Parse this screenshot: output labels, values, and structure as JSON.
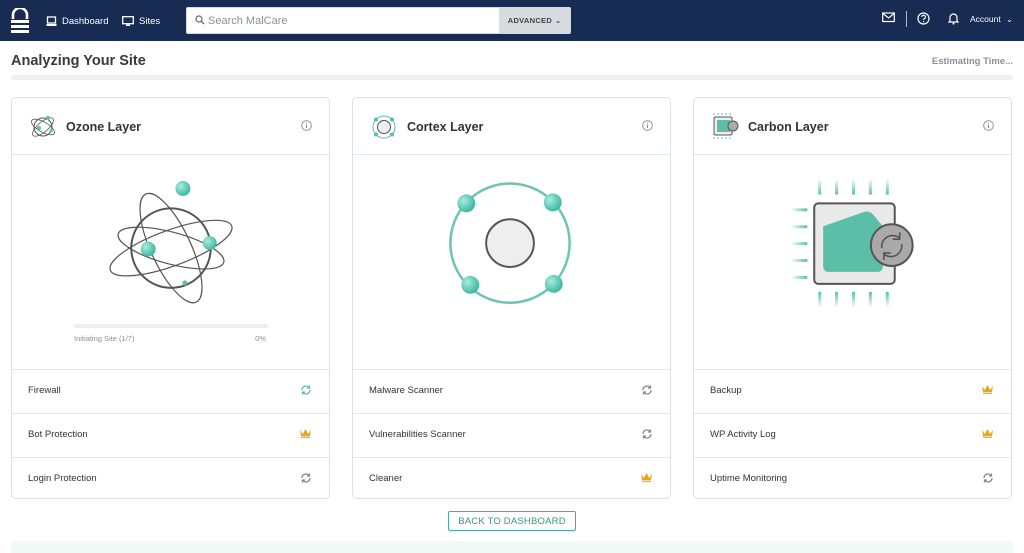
{
  "nav": {
    "dashboard": "Dashboard",
    "sites": "Sites",
    "search_placeholder": "Search MalCare",
    "advanced": "ADVANCED",
    "account": "Account",
    "icons": [
      "logo-icon",
      "dashboard-icon",
      "sites-icon",
      "search-icon",
      "mail-icon",
      "help-icon",
      "bell-icon",
      "chevron-down-icon"
    ]
  },
  "header": {
    "title": "Analyzing Your Site",
    "estimate": "Estimating Time..."
  },
  "cards": [
    {
      "title": "Ozone Layer",
      "progress_label": "Initiating Site (1/7)",
      "progress_pct": "0%",
      "progress_value": 0,
      "features": [
        {
          "label": "Firewall",
          "icon": "refresh-icon"
        },
        {
          "label": "Bot Protection",
          "icon": "crown-icon"
        },
        {
          "label": "Login Protection",
          "icon": "refresh-icon"
        }
      ]
    },
    {
      "title": "Cortex Layer",
      "features": [
        {
          "label": "Malware Scanner",
          "icon": "refresh-icon"
        },
        {
          "label": "Vulnerabilities Scanner",
          "icon": "refresh-icon"
        },
        {
          "label": "Cleaner",
          "icon": "crown-icon"
        }
      ]
    },
    {
      "title": "Carbon Layer",
      "features": [
        {
          "label": "Backup",
          "icon": "crown-icon"
        },
        {
          "label": "WP Activity Log",
          "icon": "crown-icon"
        },
        {
          "label": "Uptime Monitoring",
          "icon": "refresh-icon"
        }
      ]
    }
  ],
  "back_button": "BACK TO DASHBOARD",
  "colors": {
    "nav_bg": "#182b52",
    "accent": "#5bbfa8",
    "crown": "#e6a817"
  }
}
